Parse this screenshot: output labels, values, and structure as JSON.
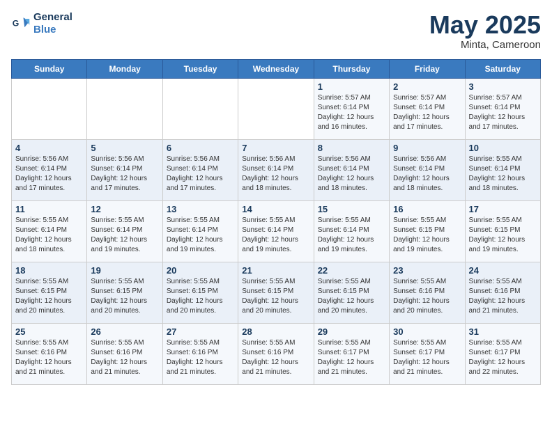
{
  "header": {
    "logo_line1": "General",
    "logo_line2": "Blue",
    "month": "May 2025",
    "location": "Minta, Cameroon"
  },
  "weekdays": [
    "Sunday",
    "Monday",
    "Tuesday",
    "Wednesday",
    "Thursday",
    "Friday",
    "Saturday"
  ],
  "weeks": [
    [
      {
        "day": "",
        "info": ""
      },
      {
        "day": "",
        "info": ""
      },
      {
        "day": "",
        "info": ""
      },
      {
        "day": "",
        "info": ""
      },
      {
        "day": "1",
        "info": "Sunrise: 5:57 AM\nSunset: 6:14 PM\nDaylight: 12 hours\nand 16 minutes."
      },
      {
        "day": "2",
        "info": "Sunrise: 5:57 AM\nSunset: 6:14 PM\nDaylight: 12 hours\nand 17 minutes."
      },
      {
        "day": "3",
        "info": "Sunrise: 5:57 AM\nSunset: 6:14 PM\nDaylight: 12 hours\nand 17 minutes."
      }
    ],
    [
      {
        "day": "4",
        "info": "Sunrise: 5:56 AM\nSunset: 6:14 PM\nDaylight: 12 hours\nand 17 minutes."
      },
      {
        "day": "5",
        "info": "Sunrise: 5:56 AM\nSunset: 6:14 PM\nDaylight: 12 hours\nand 17 minutes."
      },
      {
        "day": "6",
        "info": "Sunrise: 5:56 AM\nSunset: 6:14 PM\nDaylight: 12 hours\nand 17 minutes."
      },
      {
        "day": "7",
        "info": "Sunrise: 5:56 AM\nSunset: 6:14 PM\nDaylight: 12 hours\nand 18 minutes."
      },
      {
        "day": "8",
        "info": "Sunrise: 5:56 AM\nSunset: 6:14 PM\nDaylight: 12 hours\nand 18 minutes."
      },
      {
        "day": "9",
        "info": "Sunrise: 5:56 AM\nSunset: 6:14 PM\nDaylight: 12 hours\nand 18 minutes."
      },
      {
        "day": "10",
        "info": "Sunrise: 5:55 AM\nSunset: 6:14 PM\nDaylight: 12 hours\nand 18 minutes."
      }
    ],
    [
      {
        "day": "11",
        "info": "Sunrise: 5:55 AM\nSunset: 6:14 PM\nDaylight: 12 hours\nand 18 minutes."
      },
      {
        "day": "12",
        "info": "Sunrise: 5:55 AM\nSunset: 6:14 PM\nDaylight: 12 hours\nand 19 minutes."
      },
      {
        "day": "13",
        "info": "Sunrise: 5:55 AM\nSunset: 6:14 PM\nDaylight: 12 hours\nand 19 minutes."
      },
      {
        "day": "14",
        "info": "Sunrise: 5:55 AM\nSunset: 6:14 PM\nDaylight: 12 hours\nand 19 minutes."
      },
      {
        "day": "15",
        "info": "Sunrise: 5:55 AM\nSunset: 6:14 PM\nDaylight: 12 hours\nand 19 minutes."
      },
      {
        "day": "16",
        "info": "Sunrise: 5:55 AM\nSunset: 6:15 PM\nDaylight: 12 hours\nand 19 minutes."
      },
      {
        "day": "17",
        "info": "Sunrise: 5:55 AM\nSunset: 6:15 PM\nDaylight: 12 hours\nand 19 minutes."
      }
    ],
    [
      {
        "day": "18",
        "info": "Sunrise: 5:55 AM\nSunset: 6:15 PM\nDaylight: 12 hours\nand 20 minutes."
      },
      {
        "day": "19",
        "info": "Sunrise: 5:55 AM\nSunset: 6:15 PM\nDaylight: 12 hours\nand 20 minutes."
      },
      {
        "day": "20",
        "info": "Sunrise: 5:55 AM\nSunset: 6:15 PM\nDaylight: 12 hours\nand 20 minutes."
      },
      {
        "day": "21",
        "info": "Sunrise: 5:55 AM\nSunset: 6:15 PM\nDaylight: 12 hours\nand 20 minutes."
      },
      {
        "day": "22",
        "info": "Sunrise: 5:55 AM\nSunset: 6:15 PM\nDaylight: 12 hours\nand 20 minutes."
      },
      {
        "day": "23",
        "info": "Sunrise: 5:55 AM\nSunset: 6:16 PM\nDaylight: 12 hours\nand 20 minutes."
      },
      {
        "day": "24",
        "info": "Sunrise: 5:55 AM\nSunset: 6:16 PM\nDaylight: 12 hours\nand 21 minutes."
      }
    ],
    [
      {
        "day": "25",
        "info": "Sunrise: 5:55 AM\nSunset: 6:16 PM\nDaylight: 12 hours\nand 21 minutes."
      },
      {
        "day": "26",
        "info": "Sunrise: 5:55 AM\nSunset: 6:16 PM\nDaylight: 12 hours\nand 21 minutes."
      },
      {
        "day": "27",
        "info": "Sunrise: 5:55 AM\nSunset: 6:16 PM\nDaylight: 12 hours\nand 21 minutes."
      },
      {
        "day": "28",
        "info": "Sunrise: 5:55 AM\nSunset: 6:16 PM\nDaylight: 12 hours\nand 21 minutes."
      },
      {
        "day": "29",
        "info": "Sunrise: 5:55 AM\nSunset: 6:17 PM\nDaylight: 12 hours\nand 21 minutes."
      },
      {
        "day": "30",
        "info": "Sunrise: 5:55 AM\nSunset: 6:17 PM\nDaylight: 12 hours\nand 21 minutes."
      },
      {
        "day": "31",
        "info": "Sunrise: 5:55 AM\nSunset: 6:17 PM\nDaylight: 12 hours\nand 22 minutes."
      }
    ]
  ]
}
